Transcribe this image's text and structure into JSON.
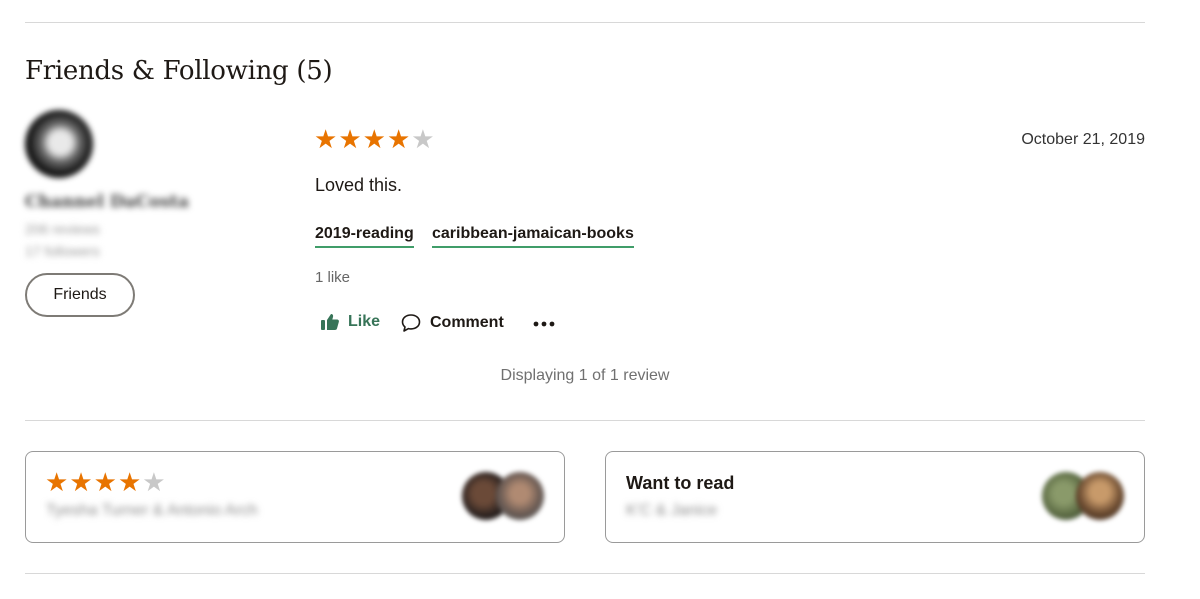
{
  "section": {
    "title": "Friends & Following (5)"
  },
  "reviewer": {
    "name": "Channel DaCosta",
    "reviews": "206 reviews",
    "followers": "17 followers",
    "relationship_button": "Friends"
  },
  "review": {
    "rating": 4,
    "max_rating": 5,
    "date": "October 21, 2019",
    "text": "Loved this.",
    "shelves": [
      "2019-reading",
      "caribbean-jamaican-books"
    ],
    "likes_count": "1 like",
    "actions": {
      "like": "Like",
      "comment": "Comment"
    }
  },
  "pagination": {
    "displaying": "Displaying 1 of 1 review"
  },
  "cards": [
    {
      "rating": 4,
      "names": "Tyesha Turner & Antonio Arch"
    },
    {
      "heading": "Want to read",
      "names": "K'C & Janice"
    }
  ],
  "colors": {
    "star_on": "#e87400",
    "star_off": "#c8c8c8",
    "shelf_underline": "#409d69",
    "like_green": "#377458"
  }
}
